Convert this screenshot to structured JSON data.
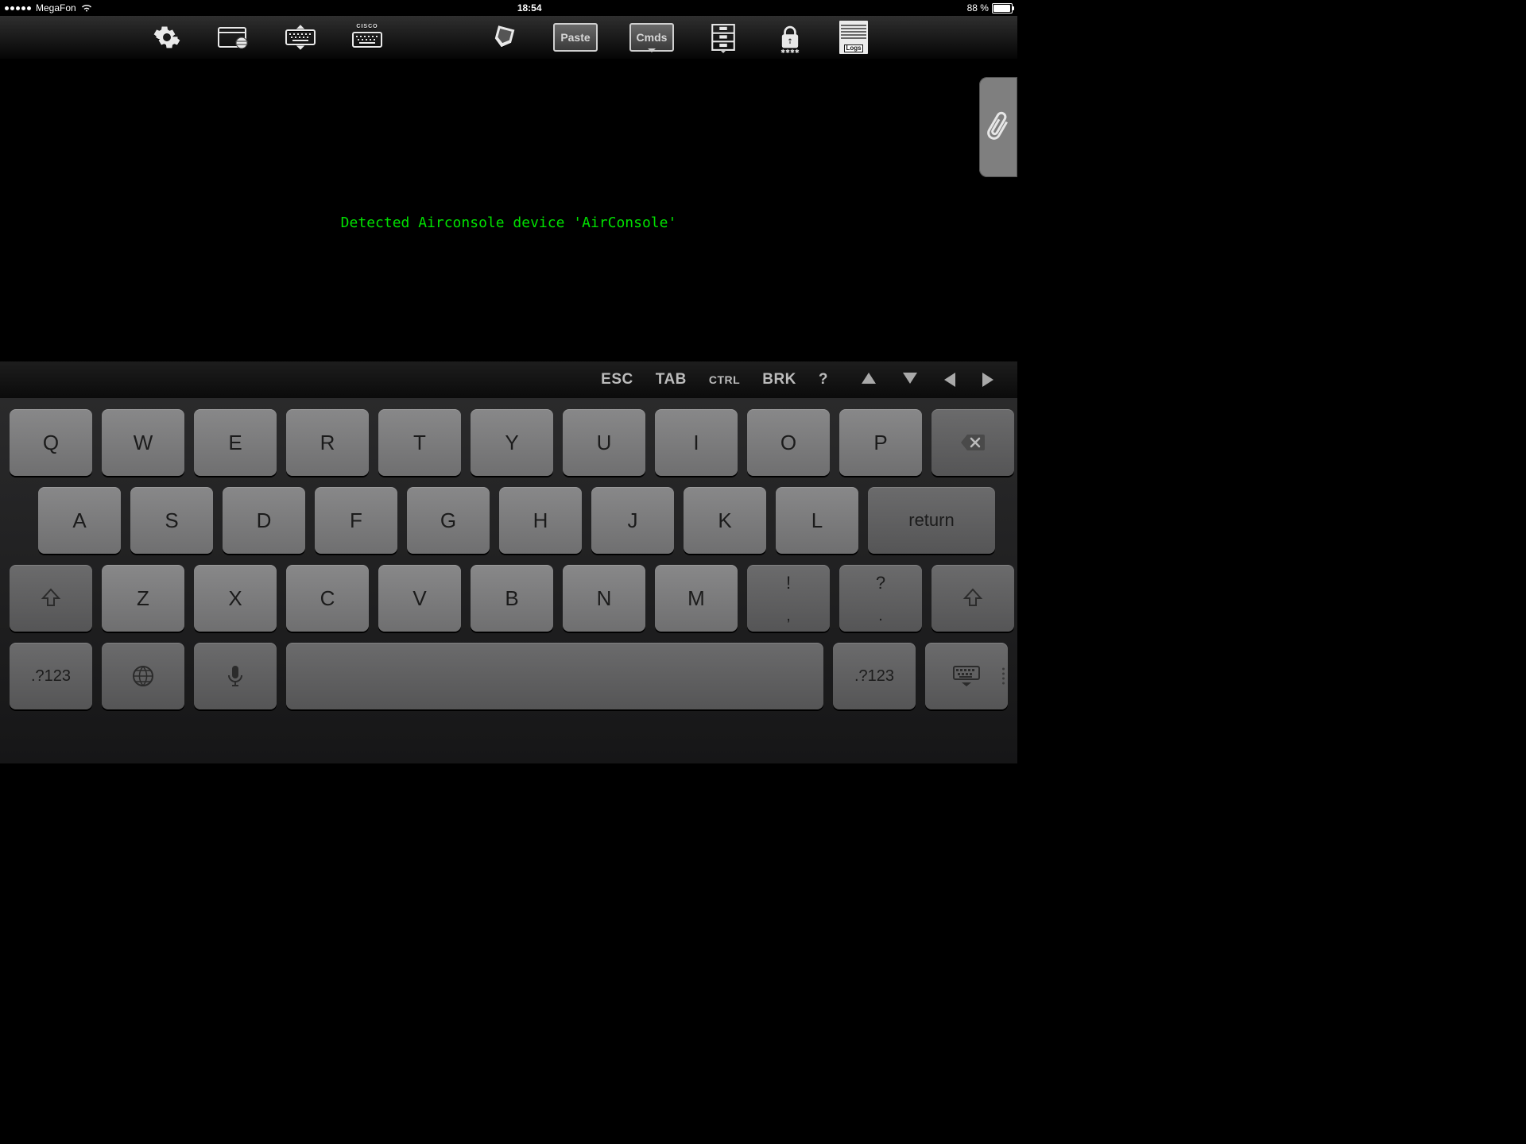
{
  "status_bar": {
    "carrier": "MegaFon",
    "time": "18:54",
    "battery_text": "88 %"
  },
  "toolbar": {
    "paste_label": "Paste",
    "cmds_label": "Cmds",
    "cisco_label": "CISCO",
    "logs_label": "Logs"
  },
  "terminal": {
    "message": "Detected Airconsole device 'AirConsole'"
  },
  "fn_keys": {
    "esc": "ESC",
    "tab": "TAB",
    "ctrl": "CTRL",
    "brk": "BRK",
    "qmark": "?"
  },
  "keyboard": {
    "row1": [
      "Q",
      "W",
      "E",
      "R",
      "T",
      "Y",
      "U",
      "I",
      "O",
      "P"
    ],
    "row2": [
      "A",
      "S",
      "D",
      "F",
      "G",
      "H",
      "J",
      "K",
      "L"
    ],
    "row3": [
      "Z",
      "X",
      "C",
      "V",
      "B",
      "N",
      "M"
    ],
    "punct1_top": "!",
    "punct1_bot": ",",
    "punct2_top": "?",
    "punct2_bot": ".",
    "return": "return",
    "num": ".?123"
  }
}
